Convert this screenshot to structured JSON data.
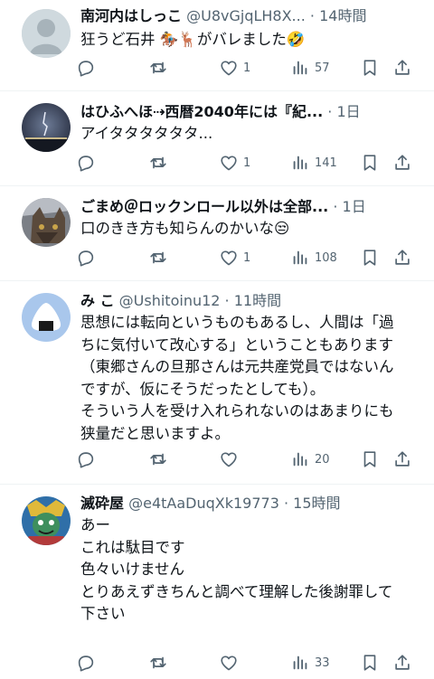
{
  "tweets": [
    {
      "name": "南河内はしっこ",
      "handle": "@U8vGjqLH8X...",
      "time": "14時間",
      "body": [
        "狂うど石井 🏇🦌がバレました🤣"
      ],
      "likes": "1",
      "views": "57",
      "avatar": "default-avatar"
    },
    {
      "name": "はひふへほ⇢西暦2040年には『紀...",
      "handle": "",
      "time": "1日",
      "body": [
        "アイタタタタタタ..."
      ],
      "likes": "1",
      "views": "141",
      "avatar": "night-sky-avatar"
    },
    {
      "name": "ごまめ＠ロックンロール以外は全部...",
      "handle": "",
      "time": "1日",
      "body": [
        "口のきき方も知らんのかいな😒"
      ],
      "likes": "1",
      "views": "108",
      "avatar": "cat-avatar"
    },
    {
      "name": "み こ",
      "handle": "@Ushitoinu12",
      "time": "11時間",
      "body": [
        "思想には転向というものもあるし、人間は「過",
        "ちに気付いて改心する」ということもあります",
        "（東郷さんの旦那さんは元共産党員ではないん",
        "ですが、仮にそうだったとしても）。",
        "そういう人を受け入れられないのはあまりにも",
        "狭量だと思いますよ。"
      ],
      "likes": "",
      "views": "20",
      "avatar": "onigiri-avatar"
    },
    {
      "name": "滅砕屋",
      "handle": "@e4tAaDuqXk19773",
      "time": "15時間",
      "body": [
        "あー",
        "これは駄目です",
        "",
        "色々いけません",
        "とりあえずきちんと調べて理解した後謝罪して",
        "下さい"
      ],
      "likes": "",
      "views": "33",
      "avatar": "character-avatar"
    }
  ],
  "separator": " · ",
  "colors": {
    "text": "#0f1419",
    "secondary": "#536471",
    "divider": "#eff3f4"
  }
}
